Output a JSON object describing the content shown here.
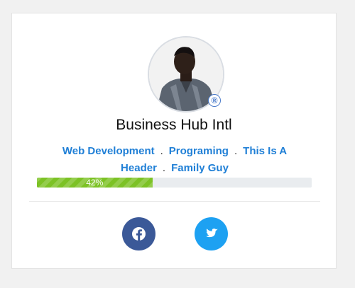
{
  "profile": {
    "name": "Business Hub Intl",
    "verified_mark": "®",
    "avatar_icon": "user-photo"
  },
  "tags": [
    {
      "label": "Web Development"
    },
    {
      "label": "Programing"
    },
    {
      "label": "This Is A Header"
    },
    {
      "label": "Family Guy"
    }
  ],
  "tag_separator": ".",
  "progress": {
    "value": 0.42,
    "label": "42%",
    "color": "#7cc225"
  },
  "social": [
    {
      "name": "facebook",
      "icon": "facebook-icon",
      "color": "#3b5998"
    },
    {
      "name": "twitter",
      "icon": "twitter-icon",
      "color": "#1da1f2"
    }
  ],
  "colors": {
    "link": "#1f7fd6",
    "card_bg": "#ffffff",
    "page_bg": "#f1f1f1"
  }
}
